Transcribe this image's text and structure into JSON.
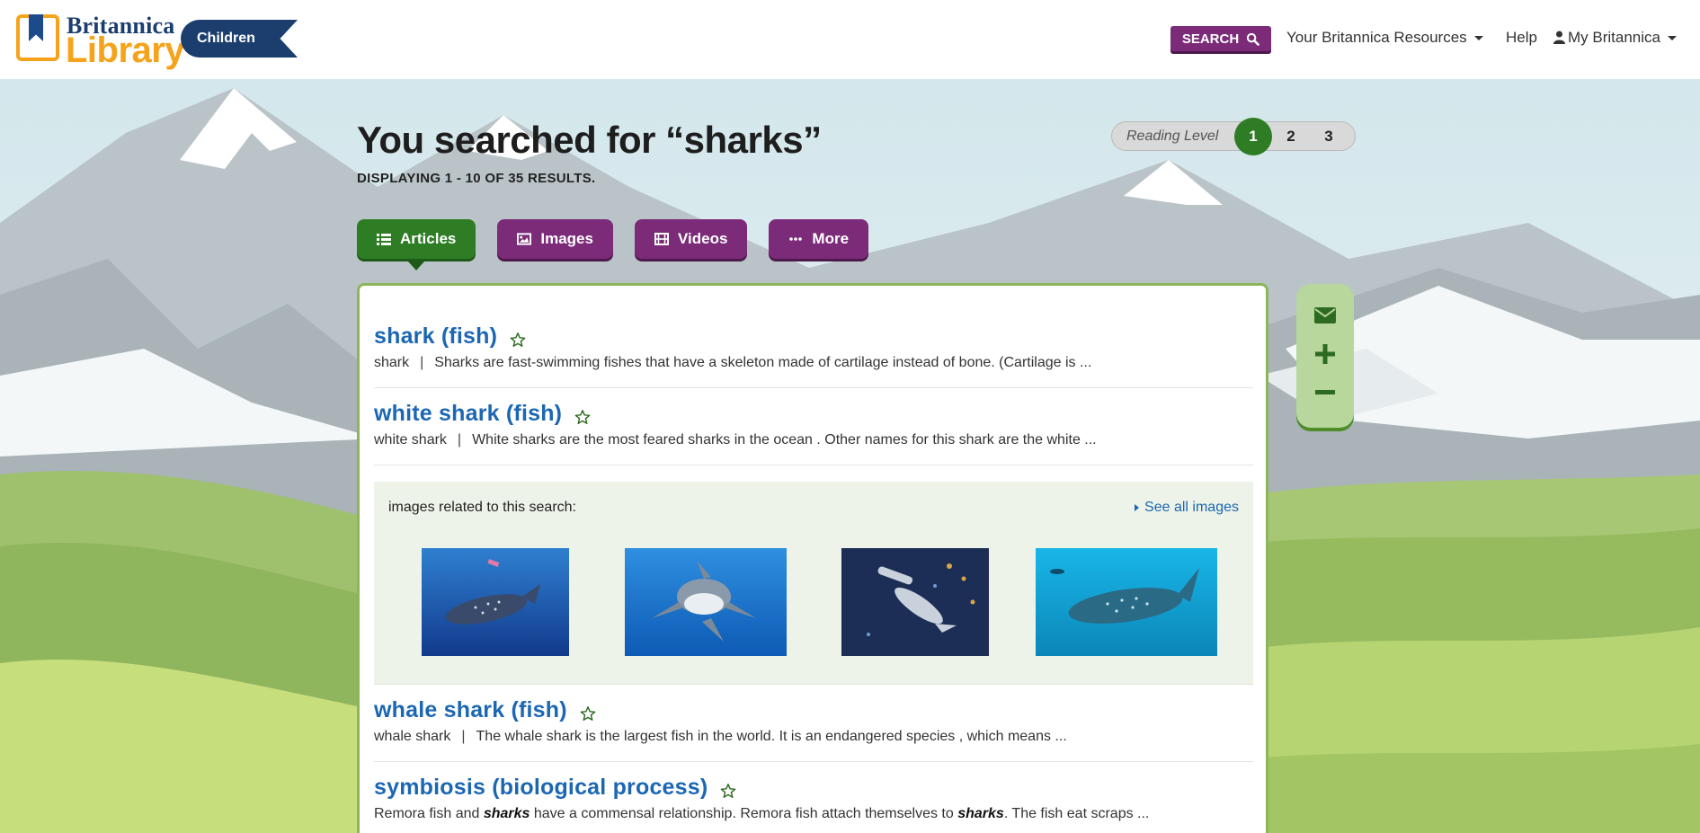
{
  "header": {
    "logo_top": "Britannica",
    "logo_bottom": "Library",
    "edition": "Children",
    "search_label": "SEARCH",
    "resources_label": "Your Britannica Resources",
    "help_label": "Help",
    "account_label": "My Britannica"
  },
  "search": {
    "title": "You searched for “sharks”",
    "results_count": "DISPLAYING 1 - 10 OF 35 RESULTS."
  },
  "reading_level": {
    "label": "Reading Level",
    "levels": [
      "1",
      "2",
      "3"
    ],
    "selected": "1"
  },
  "tabs": [
    {
      "label": "Articles",
      "icon": "list-icon",
      "active": true
    },
    {
      "label": "Images",
      "icon": "image-icon",
      "active": false
    },
    {
      "label": "Videos",
      "icon": "film-icon",
      "active": false
    },
    {
      "label": "More",
      "icon": "ellipsis-icon",
      "active": false
    }
  ],
  "results": [
    {
      "title": "shark (fish)",
      "term": "shark",
      "snippet": "Sharks are fast-swimming fishes that have a skeleton made of cartilage instead of bone. (Cartilage is ..."
    },
    {
      "title": "white shark (fish)",
      "term": "white shark",
      "snippet": "White sharks are the most feared sharks in the ocean . Other names for this shark are the white ..."
    },
    {
      "title": "whale shark (fish)",
      "term": "whale shark",
      "snippet": "The whale shark is the largest fish in the world. It is an endangered species , which means ..."
    },
    {
      "title": "symbiosis (biological process)",
      "snippet_parts": [
        "Remora fish and ",
        "sharks",
        " have a commensal relationship. Remora fish attach themselves to ",
        "sharks",
        ". The fish eat scraps ..."
      ]
    }
  ],
  "images_block": {
    "label": "images related to this search:",
    "see_all": "See all images"
  },
  "tools": [
    "email-icon",
    "zoom-in-icon",
    "zoom-out-icon"
  ],
  "colors": {
    "purple": "#7b2b78",
    "green": "#2e7d24",
    "link_blue": "#1c67b3",
    "logo_orange": "#f5a31a",
    "logo_navy": "#1b3e6f"
  }
}
